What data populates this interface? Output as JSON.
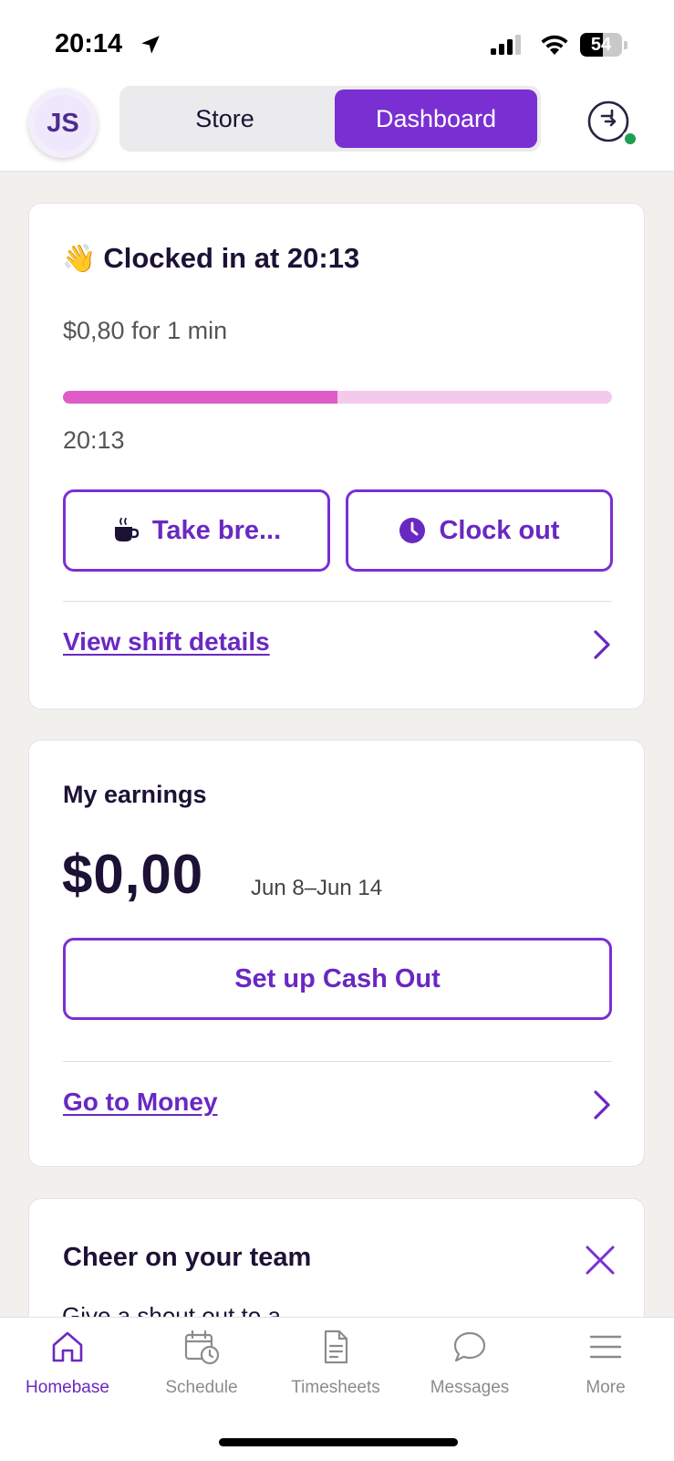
{
  "status_bar": {
    "time": "20:14",
    "battery": "54",
    "battery_level": 0.54
  },
  "header": {
    "avatar_initials": "JS",
    "segments": [
      "Store",
      "Dashboard"
    ],
    "active_segment": "Dashboard"
  },
  "clock_card": {
    "title": "Clocked in at 20:13",
    "subtitle": "$0,80 for 1 min",
    "progress_fraction": 0.5,
    "progress_time": "20:13",
    "break_button": "Take bre...",
    "clock_out_button": "Clock out",
    "link": "View shift details"
  },
  "earnings_card": {
    "title": "My earnings",
    "amount": "$0,00",
    "range": "Jun 8–Jun 14",
    "cash_out_button": "Set up Cash Out",
    "link": "Go to Money"
  },
  "cheer_card": {
    "title": "Cheer on your team",
    "peek_text": "Give a shout out to a"
  },
  "bottom_nav": {
    "items": [
      {
        "label": "Homebase",
        "icon": "home-icon"
      },
      {
        "label": "Schedule",
        "icon": "calendar-clock-icon"
      },
      {
        "label": "Timesheets",
        "icon": "document-icon"
      },
      {
        "label": "Messages",
        "icon": "chat-bubble-icon"
      },
      {
        "label": "More",
        "icon": "menu-icon"
      }
    ],
    "active": "Homebase"
  },
  "colors": {
    "accent": "#7a2fd3",
    "progress_fill": "#df5cc8",
    "progress_track": "#f4c9ec",
    "online": "#1f9d52"
  }
}
